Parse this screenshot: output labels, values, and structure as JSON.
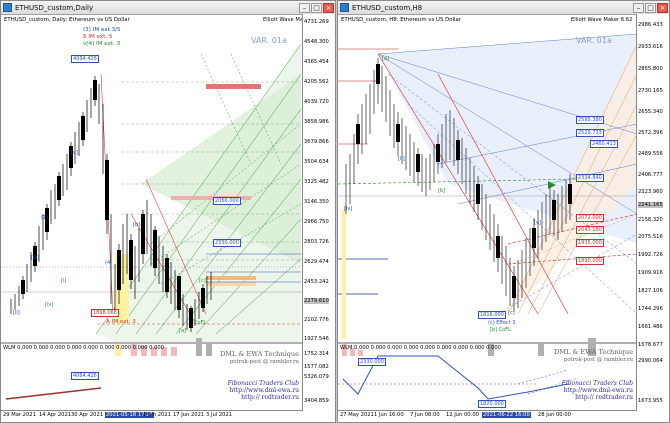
{
  "left": {
    "title": "ETHUSD_custom,Daily",
    "header": "ETHUSD_custom, Daily:  Ethereum vs US Dollar",
    "ewm": "Elliott Wave Maker 6.62",
    "var": "VAR. 01a",
    "legend": [
      "(3) IM ext.3/5",
      "5 IM ext. 5",
      "v[4] IM ext. 3"
    ],
    "price_labels": [
      "4731.269",
      "4548.300",
      "4365.454",
      "4205.562",
      "4039.720",
      "3858.986",
      "3679.866",
      "3504.634",
      "3325.482",
      "3146.350",
      "2966.750",
      "2803.726",
      "2629.474",
      "2453.242",
      "2279.610",
      "2102.776",
      "1927.546",
      "1752.314",
      "1577.082",
      "1401.850",
      "5326.079",
      "3404.859"
    ],
    "current_price": "2279.610",
    "time_labels": [
      "29 Mar 2021",
      "14 Apr 2021",
      "30 Apr 2021",
      "2021-05-18 17:26",
      "1 Jun 2021",
      "17 Jun 2021",
      "3 Jul 2021"
    ],
    "highlight_time": "2021-05-18 17:26",
    "indicator_header": "WLM 0.000 0.000 0.000 0.000 0.000 0.000 0.000 0.000 0.000",
    "tags": [
      "4064.426",
      "2066.000",
      "2330.000",
      "1898.068",
      "4064.426"
    ],
    "wave_labels": [
      "A IM ext. 3",
      "CoFL"
    ],
    "watermark": {
      "line1": "DML & EWA Technique",
      "line2": "potrok-post @ rambler.ru",
      "line3": "Fibonacci Traders Club",
      "line4": "http://www.dml-ewa.ru",
      "line5": "http:// redtrader.ru"
    }
  },
  "right": {
    "title": "ETHUSD_custom,H8",
    "header": "ETHUSD_custom, H8:  Ethereum vs US Dollar",
    "ewm": "Elliott Wave Maker 6.62",
    "var": "VAR. 01a",
    "price_labels": [
      "2986.433",
      "2933.616",
      "2855.800",
      "2730.165",
      "2655.340",
      "2572.396",
      "2489.556",
      "2406.777",
      "2323.960",
      "2241.165",
      "2158.320",
      "2075.516",
      "1992.726",
      "1909.916",
      "1827.106",
      "1744.296",
      "1661.486",
      "1578.677",
      "2990.064",
      "1673.955"
    ],
    "current_price": "2241.165",
    "time_labels": [
      "27 May 2021",
      "1 Jun 16:00",
      "7 Jun 08:00",
      "12 Jun 00:00",
      "17 Jun 00:00",
      "2021-06-22 16:00",
      "28 Jun 00:00"
    ],
    "highlight_time": "2021-06-22 16:00",
    "indicator_header": "WLM 0.000 0.000 0.000 0.000 0.000 0.000 0.000 0.000 0.000",
    "tags": [
      "2595.380",
      "2529.733",
      "2460.413",
      "2334.840",
      "2072.000",
      "1935.000",
      "1890.000",
      "2043.180",
      "1816.000",
      "1820.000",
      "2330.000"
    ],
    "wave_labels": [
      "(c) Effect 3",
      "[b] CoFL"
    ],
    "watermark": {
      "line1": "DML & EWA Technique",
      "line2": "potrok-post @ rambler.ru",
      "line3": "Fibonacci Traders Club",
      "line4": "http://www.dml-ewa.ru",
      "line5": "http:// redtrader.ru"
    }
  }
}
